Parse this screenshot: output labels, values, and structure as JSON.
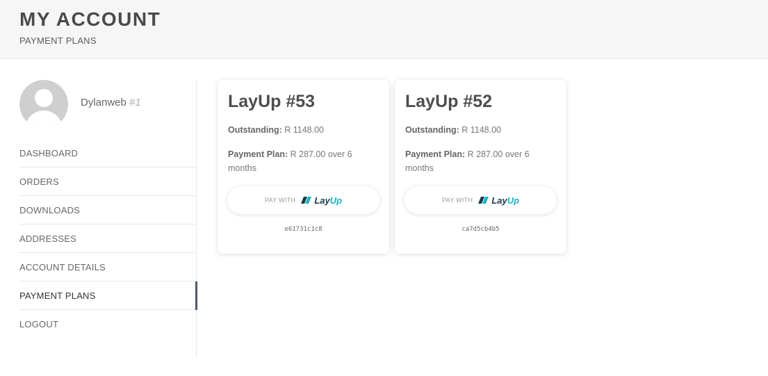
{
  "header": {
    "title": "MY ACCOUNT",
    "subtitle": "PAYMENT PLANS"
  },
  "user": {
    "name": "Dylanweb",
    "id": "#1"
  },
  "nav": {
    "items": [
      {
        "label": "DASHBOARD",
        "active": false
      },
      {
        "label": "ORDERS",
        "active": false
      },
      {
        "label": "DOWNLOADS",
        "active": false
      },
      {
        "label": "ADDRESSES",
        "active": false
      },
      {
        "label": "ACCOUNT DETAILS",
        "active": false
      },
      {
        "label": "PAYMENT PLANS",
        "active": true
      },
      {
        "label": "LOGOUT",
        "active": false
      }
    ]
  },
  "cards": [
    {
      "title": "LayUp #53",
      "outstanding_label": "Outstanding:",
      "outstanding_value": "R 1148.00",
      "plan_label": "Payment Plan:",
      "plan_value": "R 287.00 over 6 months",
      "button": {
        "pay_with": "PAY WITH",
        "brand_lay": "Lay",
        "brand_up": "Up"
      },
      "reference": "e61731c1c8"
    },
    {
      "title": "LayUp #52",
      "outstanding_label": "Outstanding:",
      "outstanding_value": "R 1148.00",
      "plan_label": "Payment Plan:",
      "plan_value": "R 287.00 over 6 months",
      "button": {
        "pay_with": "PAY WITH",
        "brand_lay": "Lay",
        "brand_up": "Up"
      },
      "reference": "ca7d5cb4b5"
    }
  ],
  "colors": {
    "accent": "#4b5a6b",
    "brand_dark": "#1a3a4a",
    "brand_teal": "#19b3c7"
  },
  "icons": {
    "avatar": "user-silhouette-icon",
    "brand": "layup-logo-icon"
  }
}
